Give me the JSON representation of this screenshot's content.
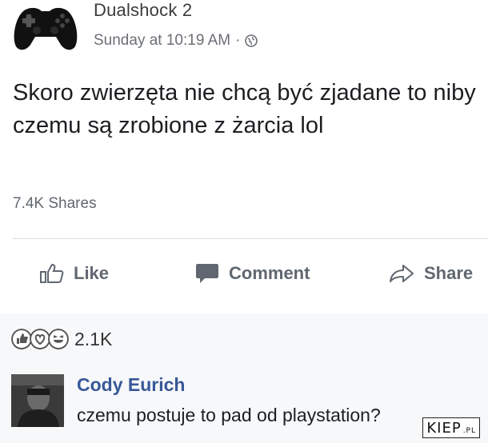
{
  "post": {
    "author": "Dualshock 2",
    "timestamp": "Sunday at 10:19 AM",
    "separator": "·",
    "audience_icon": "globe-icon",
    "text": "Skoro zwierzęta nie chcą być zjadane to niby czemu są zrobione z żarcia lol",
    "shares": "7.4K Shares"
  },
  "actions": {
    "like_label": "Like",
    "comment_label": "Comment",
    "share_label": "Share"
  },
  "reactions": {
    "icons": [
      "like-reaction-icon",
      "love-reaction-icon",
      "haha-reaction-icon"
    ],
    "count": "2.1K"
  },
  "comment": {
    "author": "Cody Eurich",
    "text": "czemu postuje to pad od playstation?"
  },
  "watermark": {
    "text": "KIEP",
    "suffix": ".PL"
  },
  "colors": {
    "author_link": "#385898",
    "meta_gray": "#6b6f75",
    "action_gray": "#606770"
  }
}
